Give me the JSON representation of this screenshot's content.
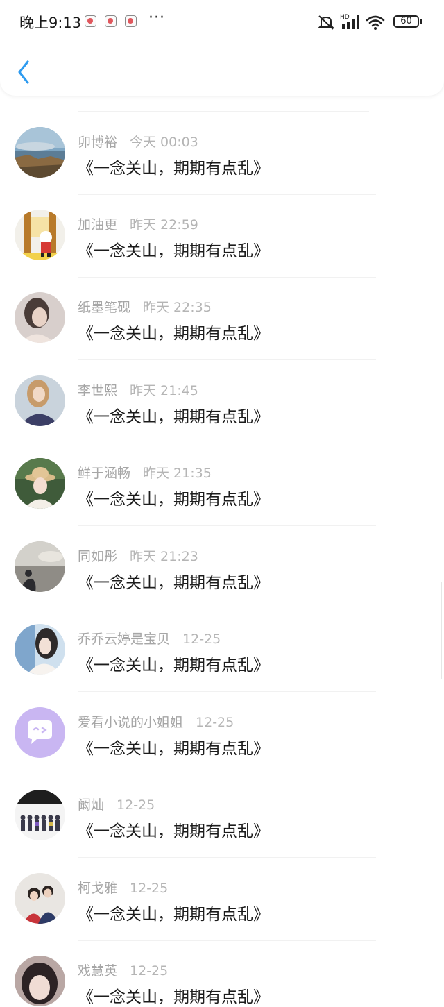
{
  "status_bar": {
    "time": "晚上9:13",
    "more": "···",
    "battery": "60"
  },
  "nav": {
    "back_icon": "chevron-left-icon"
  },
  "colors": {
    "accent": "#2e9bf0",
    "meta_text": "#a6a6a6",
    "message_text": "#1c1c1c"
  },
  "comments": [
    {
      "user": "卯博裕",
      "time": "今天 00:03",
      "text": "《一念关山，期期有点乱》"
    },
    {
      "user": "加油更",
      "time": "昨天 22:59",
      "text": "《一念关山，期期有点乱》"
    },
    {
      "user": "纸墨笔砚",
      "time": "昨天 22:35",
      "text": "《一念关山，期期有点乱》"
    },
    {
      "user": "李世熙",
      "time": "昨天 21:45",
      "text": "《一念关山，期期有点乱》"
    },
    {
      "user": "鲜于涵畅",
      "time": "昨天 21:35",
      "text": "《一念关山，期期有点乱》"
    },
    {
      "user": "同如彤",
      "time": "昨天 21:23",
      "text": "《一念关山，期期有点乱》"
    },
    {
      "user": "乔乔云婷是宝贝",
      "time": "12-25",
      "text": "《一念关山，期期有点乱》"
    },
    {
      "user": "爱看小说的小姐姐",
      "time": "12-25",
      "text": "《一念关山，期期有点乱》"
    },
    {
      "user": "阚灿",
      "time": "12-25",
      "text": "《一念关山，期期有点乱》"
    },
    {
      "user": "柯戈雅",
      "time": "12-25",
      "text": "《一念关山，期期有点乱》"
    },
    {
      "user": "戏慧英",
      "time": "12-25",
      "text": "《一念关山，期期有点乱》"
    }
  ]
}
